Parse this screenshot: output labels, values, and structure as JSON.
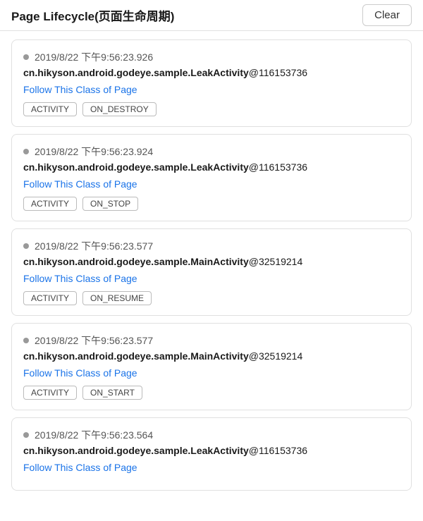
{
  "header": {
    "title": "Page Lifecycle(页面生命周期)",
    "clear_label": "Clear"
  },
  "cards": [
    {
      "timestamp": "2019/8/22 下午9:56:23.926",
      "class_name": "cn.hikyson.android.godeye.sample.LeakActivity",
      "instance_id": "@116153736",
      "follow_label": "Follow This Class of Page",
      "tags": [
        "ACTIVITY",
        "ON_DESTROY"
      ]
    },
    {
      "timestamp": "2019/8/22 下午9:56:23.924",
      "class_name": "cn.hikyson.android.godeye.sample.LeakActivity",
      "instance_id": "@116153736",
      "follow_label": "Follow This Class of Page",
      "tags": [
        "ACTIVITY",
        "ON_STOP"
      ]
    },
    {
      "timestamp": "2019/8/22 下午9:56:23.577",
      "class_name": "cn.hikyson.android.godeye.sample.MainActivity",
      "instance_id": "@32519214",
      "follow_label": "Follow This Class of Page",
      "tags": [
        "ACTIVITY",
        "ON_RESUME"
      ]
    },
    {
      "timestamp": "2019/8/22 下午9:56:23.577",
      "class_name": "cn.hikyson.android.godeye.sample.MainActivity",
      "instance_id": "@32519214",
      "follow_label": "Follow This Class of Page",
      "tags": [
        "ACTIVITY",
        "ON_START"
      ]
    },
    {
      "timestamp": "2019/8/22 下午9:56:23.564",
      "class_name": "cn.hikyson.android.godeye.sample.LeakActivity",
      "instance_id": "@116153736",
      "follow_label": "Follow This Class of Page",
      "tags": []
    }
  ]
}
